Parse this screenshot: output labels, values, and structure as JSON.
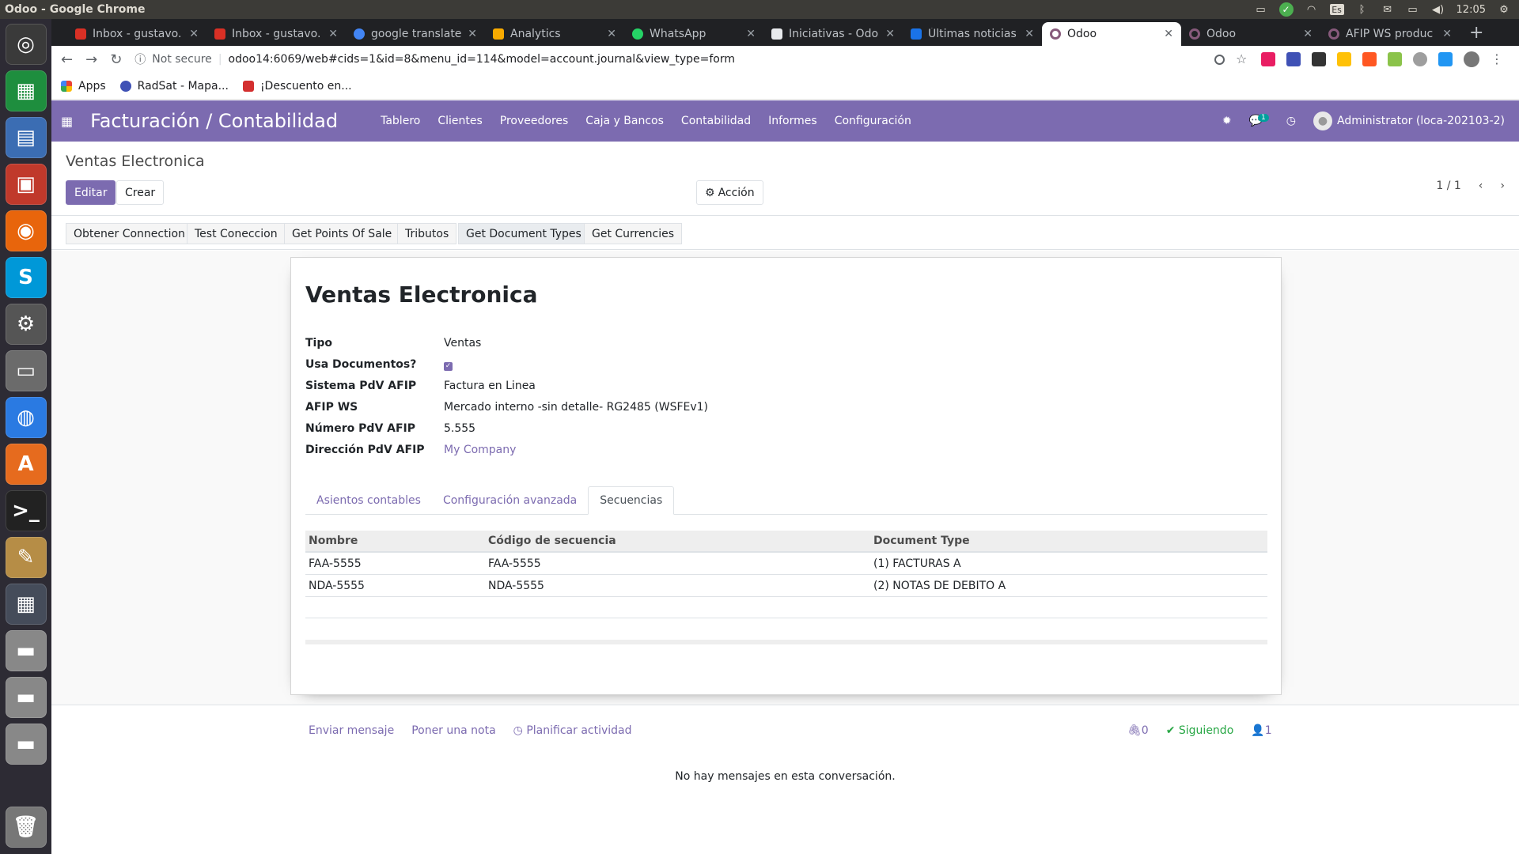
{
  "window": {
    "title": "Odoo - Google Chrome",
    "clock": "12:05",
    "keyboard": "Es"
  },
  "tabs": [
    {
      "label": "Inbox - gustavo.",
      "color": "#d93025"
    },
    {
      "label": "Inbox - gustavo.",
      "color": "#d93025"
    },
    {
      "label": "google translate",
      "color": "#4285f4"
    },
    {
      "label": "Analytics",
      "color": "#f9ab00"
    },
    {
      "label": "WhatsApp",
      "color": "#25d366"
    },
    {
      "label": "Iniciativas - Odo",
      "color": "#e8eaed"
    },
    {
      "label": "Últimas noticias",
      "color": "#1a73e8"
    },
    {
      "label": "Odoo",
      "color": "#875a7b",
      "active": true
    },
    {
      "label": "Odoo",
      "color": "#875a7b"
    },
    {
      "label": "AFIP WS produc",
      "color": "#875a7b"
    }
  ],
  "address": {
    "security": "Not secure",
    "url": "odoo14:6069/web#cids=1&id=8&menu_id=114&model=account.journal&view_type=form"
  },
  "bookmarks": [
    {
      "label": "Apps"
    },
    {
      "label": "RadSat - Mapa..."
    },
    {
      "label": "¡Descuento en..."
    }
  ],
  "navbar": {
    "brand": "Facturación / Contabilidad",
    "menu": [
      "Tablero",
      "Clientes",
      "Proveedores",
      "Caja y Bancos",
      "Contabilidad",
      "Informes",
      "Configuración"
    ],
    "chat_count": "1",
    "user": "Administrator (loca-202103-2)"
  },
  "control": {
    "breadcrumb": "Ventas Electronica",
    "edit": "Editar",
    "create": "Crear",
    "action": "Acción",
    "pager": "1 / 1"
  },
  "header_buttons": [
    "Obtener Connection",
    "Test Coneccion",
    "Get Points Of Sale",
    "Tributos",
    "Get Document Types",
    "Get Currencies"
  ],
  "form": {
    "title": "Ventas Electronica",
    "fields": [
      {
        "label": "Tipo",
        "value": "Ventas"
      },
      {
        "label": "Usa Documentos?",
        "value": ""
      },
      {
        "label": "Sistema PdV AFIP",
        "value": "Factura en Linea"
      },
      {
        "label": "AFIP WS",
        "value": "Mercado interno -sin detalle- RG2485 (WSFEv1)"
      },
      {
        "label": "Número PdV AFIP",
        "value": "5.555"
      },
      {
        "label": "Dirección PdV AFIP",
        "value": "My Company"
      }
    ],
    "tabs": [
      "Asientos contables",
      "Configuración avanzada",
      "Secuencias"
    ],
    "table": {
      "headers": [
        "Nombre",
        "Código de secuencia",
        "Document Type"
      ],
      "rows": [
        [
          "FAA-5555",
          "FAA-5555",
          "(1) FACTURAS A"
        ],
        [
          "NDA-5555",
          "NDA-5555",
          "(2) NOTAS DE DEBITO A"
        ]
      ]
    }
  },
  "chatter": {
    "send": "Enviar mensaje",
    "note": "Poner una nota",
    "activity": "Planificar actividad",
    "attachments": "0",
    "following": "Siguiendo",
    "followers": "1",
    "empty": "No hay mensajes en esta conversación."
  }
}
